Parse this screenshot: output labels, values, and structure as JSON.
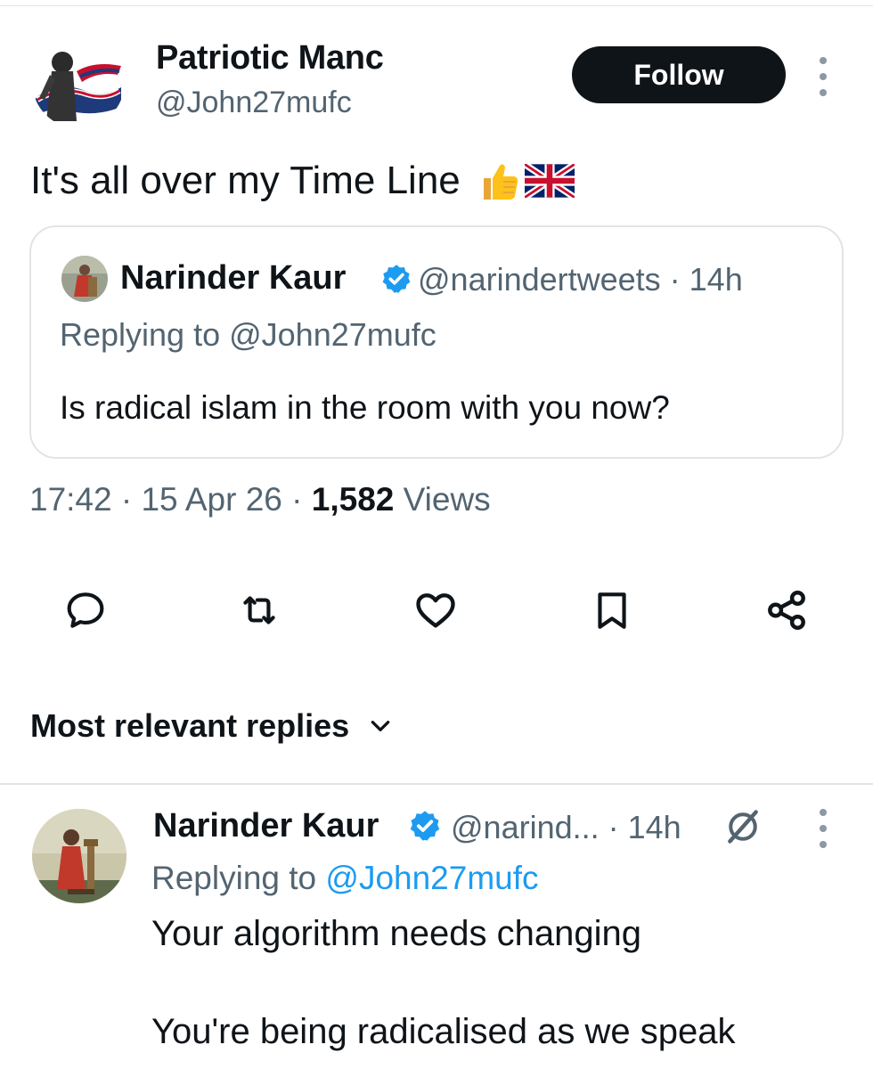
{
  "tweet": {
    "author_name": "Patriotic Manc",
    "author_handle": "@John27mufc",
    "follow_label": "Follow",
    "text": "It's all over my Time Line",
    "emoji": [
      "thumbs-up",
      "union-jack-flag"
    ],
    "quote": {
      "author_name": "Narinder Kaur",
      "verified": true,
      "handle_time": "@narindertweets · 14h",
      "replying_to": "Replying to @John27mufc",
      "text": "Is radical islam in the room with you now?"
    },
    "timestamp": "17:42 · 15 Apr 26 · ",
    "views_count": "1,582",
    "views_label": " Views",
    "actions": [
      "reply-icon",
      "retweet-icon",
      "like-icon",
      "bookmark-icon",
      "share-icon"
    ]
  },
  "replies_sort": {
    "label": "Most relevant replies"
  },
  "reply": {
    "author_name": "Narinder Kaur",
    "verified": true,
    "handle_time": "@narind... · 14h",
    "replying_prefix": "Replying to ",
    "replying_handle": "@John27mufc",
    "text_line1": "Your algorithm needs changing",
    "text_line2": "You're being radicalised as we speak"
  },
  "colors": {
    "text_primary": "#0f1419",
    "text_secondary": "#536471",
    "link": "#1d9bf0",
    "border": "#e1e4e6",
    "follow_bg": "#0f1419"
  }
}
